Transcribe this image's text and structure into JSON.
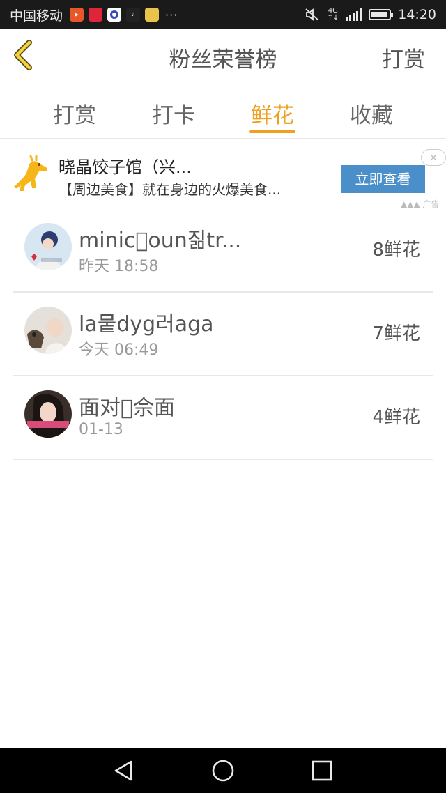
{
  "status_bar": {
    "carrier": "中国移动",
    "time": "14:20",
    "network": "4G",
    "app_icons": [
      {
        "name": "video-app-icon",
        "color": "#e8572a"
      },
      {
        "name": "xiaohongshu-app-icon",
        "color": "#e0253a"
      },
      {
        "name": "circle-app-icon",
        "color": "#3a4bb8"
      },
      {
        "name": "music-app-icon",
        "color": "#222222"
      },
      {
        "name": "duck-app-icon",
        "color": "#e8c44a"
      }
    ],
    "more": "···",
    "battery_level": 0.9
  },
  "header": {
    "title": "粉丝荣誉榜",
    "action": "打赏"
  },
  "tabs": {
    "items": [
      {
        "label": "打赏",
        "active": false
      },
      {
        "label": "打卡",
        "active": false
      },
      {
        "label": "鲜花",
        "active": true
      },
      {
        "label": "收藏",
        "active": false
      }
    ],
    "accent_color": "#f0a020"
  },
  "ad": {
    "title": "晓晶饺子馆（兴...",
    "description": "【周边美食】就在身边的火爆美食...",
    "button_label": "立即查看",
    "tag": "广告",
    "close": "×"
  },
  "fans": [
    {
      "name": "minic𮉈oun짊tr...",
      "time": "昨天 18:58",
      "count": "8鲜花"
    },
    {
      "name": "la뭍dyg러aga",
      "time": "今天 06:49",
      "count": "7鲜花"
    },
    {
      "name": "面对𠃧佘面",
      "time": "01-13",
      "count": "4鲜花"
    }
  ]
}
